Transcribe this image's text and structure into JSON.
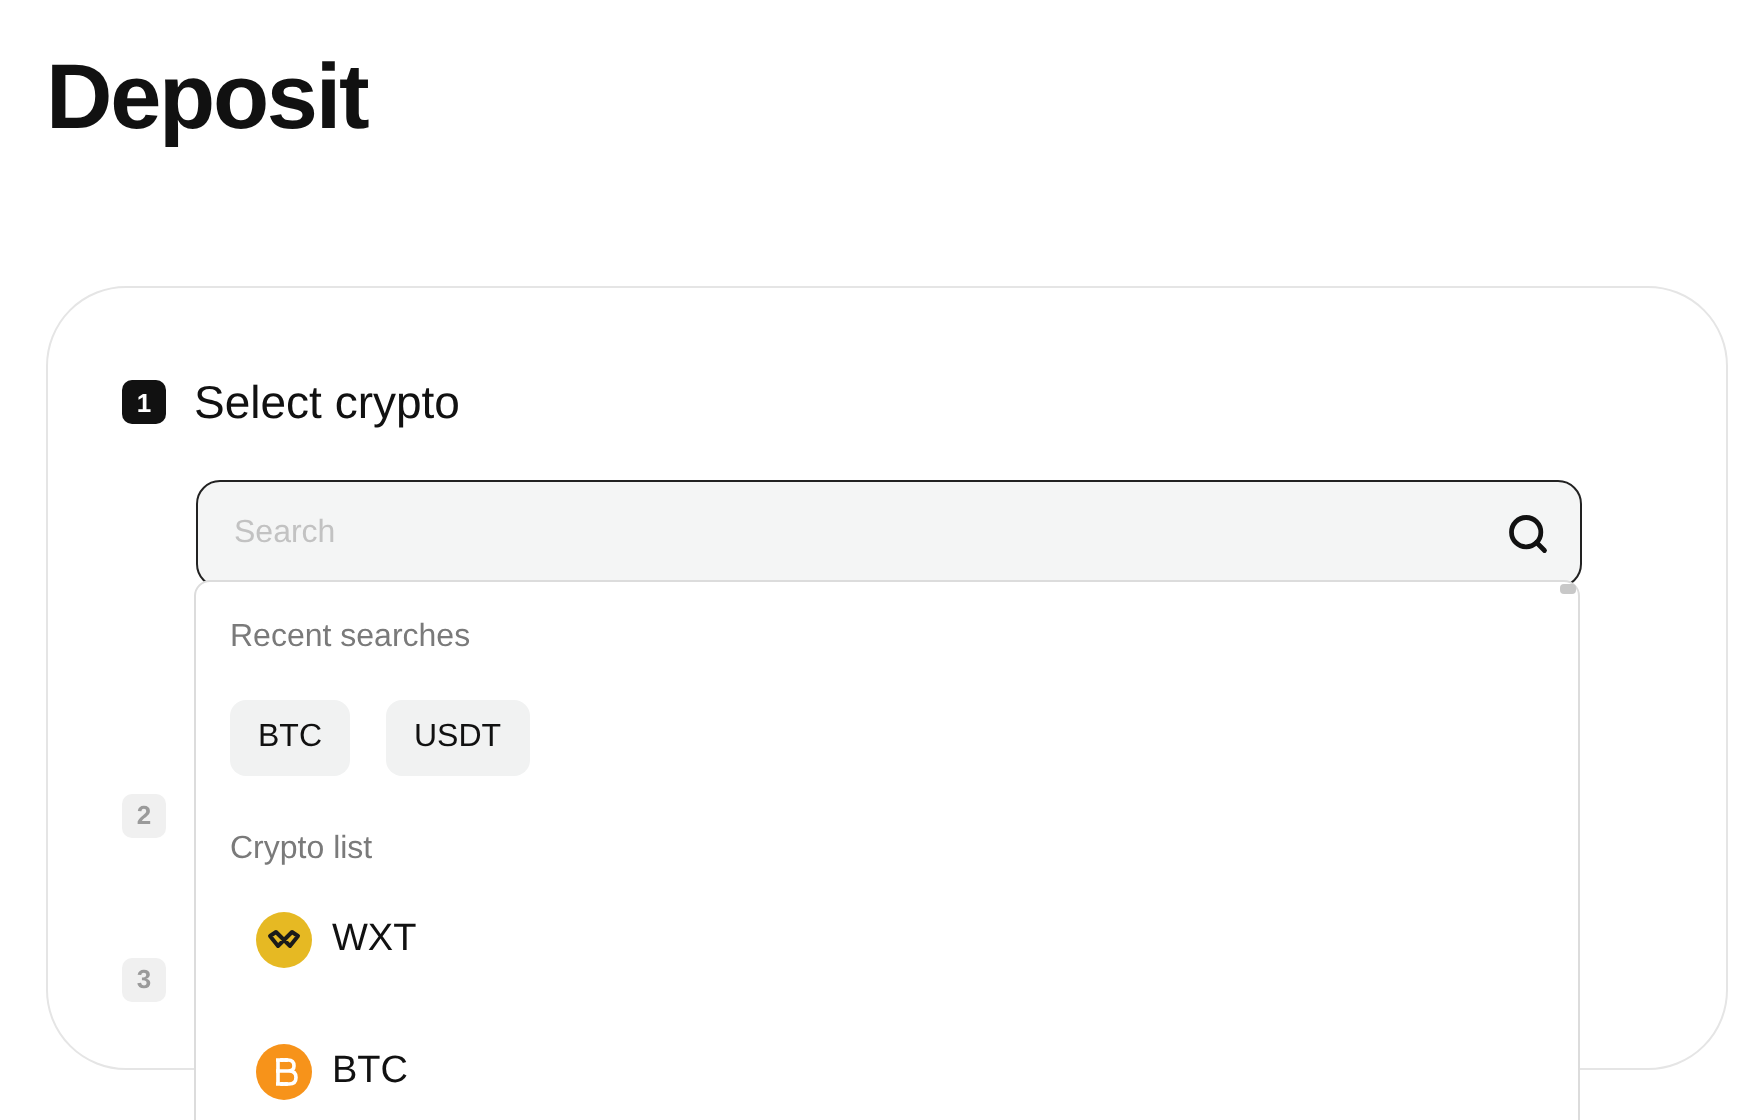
{
  "title": "Deposit",
  "steps": [
    {
      "number": "1",
      "label": "Select crypto",
      "active": true
    },
    {
      "number": "2",
      "active": false
    },
    {
      "number": "3",
      "active": false
    }
  ],
  "search": {
    "placeholder": "Search"
  },
  "dropdown": {
    "recent_title": "Recent searches",
    "recent": [
      "BTC",
      "USDT"
    ],
    "list_title": "Crypto list",
    "coins": [
      {
        "symbol": "WXT",
        "kind": "wxt"
      },
      {
        "symbol": "BTC",
        "kind": "btc"
      }
    ]
  }
}
